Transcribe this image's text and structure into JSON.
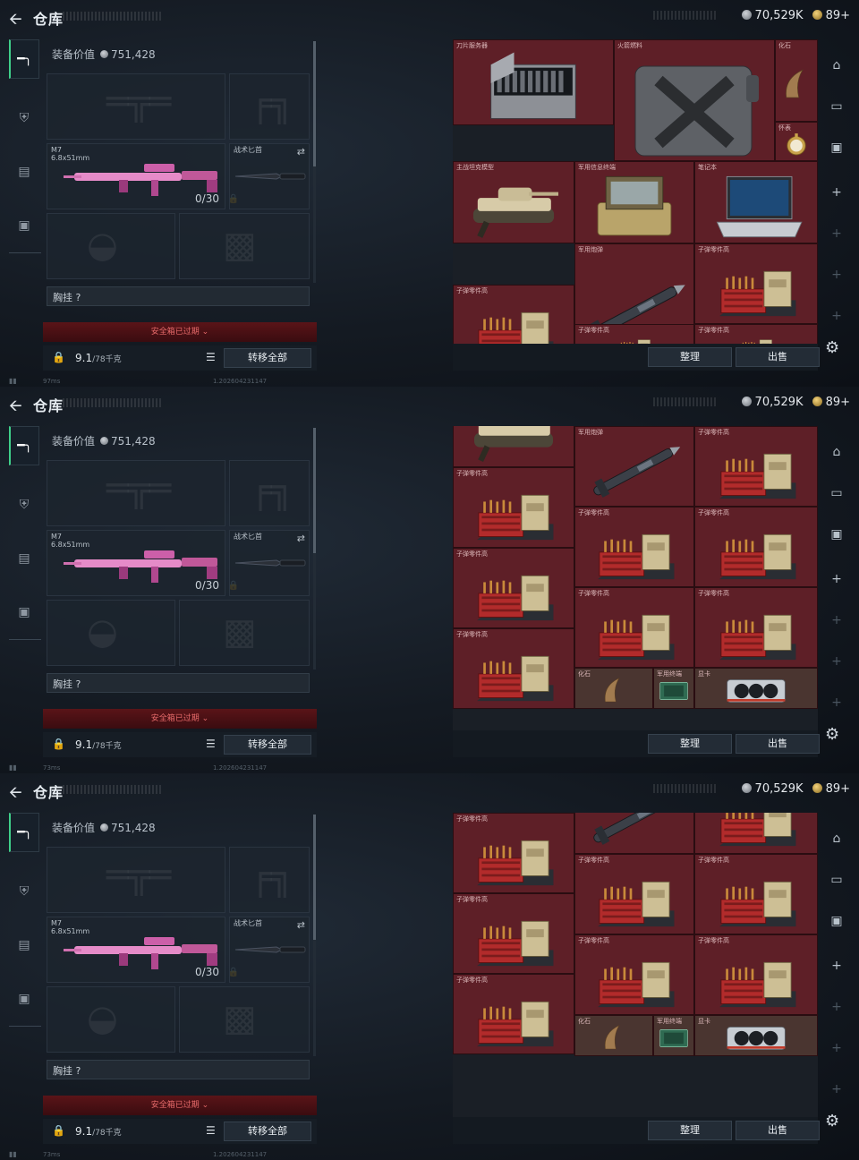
{
  "topbar": {
    "title": "仓库",
    "currency1": "70,529K",
    "currency2": "89+"
  },
  "equip": {
    "value_label": "装备价值",
    "value": "751,428",
    "primary": {
      "name": "M7",
      "ammo_type": "6.8x51mm",
      "ammo": "0/30"
    },
    "melee": {
      "name": "战术匕首"
    },
    "chest_label": "胸挂",
    "chest_hint": "?",
    "safe_box": "安全箱已过期",
    "weight": "9.1",
    "weight_unit": "/78千克",
    "transfer_all": "转移全部"
  },
  "stash": {
    "sort": "整理",
    "sell": "出售"
  },
  "status": {
    "latency1": "97ms",
    "latency2": "73ms",
    "latency3": "73ms",
    "version": "1.202604231147"
  },
  "panels": [
    {
      "items": [
        {
          "label": "刀片服务器",
          "art": "server"
        },
        {
          "label": "火箭燃料",
          "art": "jerrycan"
        },
        {
          "label": "化石",
          "art": "claw"
        },
        {
          "label": "怀表",
          "art": "watch"
        },
        {
          "label": "主战坦克模型",
          "art": "tank"
        },
        {
          "label": "军用信息终端",
          "art": "terminal"
        },
        {
          "label": "笔记本",
          "art": "laptop"
        },
        {
          "label": "军用炮弹",
          "art": "missile"
        },
        {
          "label": "子弹零件高",
          "art": "ammo"
        },
        {
          "label": "子弹零件高",
          "art": "ammo"
        },
        {
          "label": "子弹零件高",
          "art": "ammo"
        },
        {
          "label": "子弹零件高",
          "art": "ammo"
        }
      ]
    },
    {
      "items": [
        {
          "label": "",
          "art": "tank"
        },
        {
          "label": "军用炮弹",
          "art": "missile"
        },
        {
          "label": "子弹零件高",
          "art": "ammo"
        },
        {
          "label": "子弹零件高",
          "art": "ammo"
        },
        {
          "label": "子弹零件高",
          "art": "ammo"
        },
        {
          "label": "子弹零件高",
          "art": "ammo"
        },
        {
          "label": "子弹零件高",
          "art": "ammo"
        },
        {
          "label": "子弹零件高",
          "art": "ammo"
        },
        {
          "label": "子弹零件高",
          "art": "ammo"
        },
        {
          "label": "子弹零件高",
          "art": "ammo"
        },
        {
          "label": "化石",
          "art": "claw"
        },
        {
          "label": "军用终端",
          "art": "chip"
        },
        {
          "label": "显卡",
          "art": "gpu"
        }
      ]
    },
    {
      "items": [
        {
          "label": "",
          "art": "missile"
        },
        {
          "label": "",
          "art": "ammo"
        },
        {
          "label": "子弹零件高",
          "art": "ammo"
        },
        {
          "label": "子弹零件高",
          "art": "ammo"
        },
        {
          "label": "子弹零件高",
          "art": "ammo"
        },
        {
          "label": "子弹零件高",
          "art": "ammo"
        },
        {
          "label": "子弹零件高",
          "art": "ammo"
        },
        {
          "label": "子弹零件高",
          "art": "ammo"
        },
        {
          "label": "子弹零件高",
          "art": "ammo"
        },
        {
          "label": "子弹零件高",
          "art": "ammo"
        },
        {
          "label": "子弹零件高",
          "art": "ammo"
        },
        {
          "label": "化石",
          "art": "claw"
        },
        {
          "label": "军用终端",
          "art": "chip"
        },
        {
          "label": "显卡",
          "art": "gpu"
        }
      ]
    }
  ]
}
